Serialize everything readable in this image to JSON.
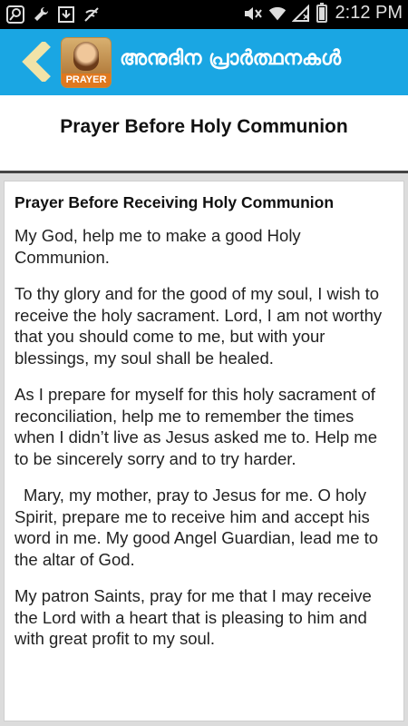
{
  "status_bar": {
    "time": "2:12 PM",
    "left_icons": [
      "search-icon",
      "wrench-icon",
      "download-icon",
      "signal-off-icon"
    ],
    "right_icons": [
      "mute-icon",
      "wifi-icon",
      "no-signal-icon",
      "battery-icon"
    ]
  },
  "app_bar": {
    "title": "അനുദിന പ്രാർത്ഥനകൾ",
    "logo_label": "PRAYER",
    "back_icon": "back-chevron-icon",
    "color": "#1aa6e3"
  },
  "header": {
    "title": "Prayer Before Holy Communion"
  },
  "content": {
    "heading": "Prayer Before Receiving Holy Communion",
    "paragraphs": [
      "My God, help me to make a good Holy Communion.",
      "To thy glory and for the good of my soul, I wish to receive the holy sacrament. Lord, I am not worthy that you should come to me, but with your blessings, my soul shall be healed.",
      "As I prepare for myself for this holy sacrament of reconciliation, help me to remember the times when I didn’t live as Jesus asked me to. Help me to be sincerely sorry and to try harder.",
      "Mary, my mother, pray to Jesus for me. O holy Spirit, prepare me to receive him and accept his word in me.  My good Angel Guardian, lead me to the altar of God.",
      "My patron Saints, pray for me that I may receive the Lord with a heart that is pleasing to him and with great profit to my soul."
    ]
  }
}
